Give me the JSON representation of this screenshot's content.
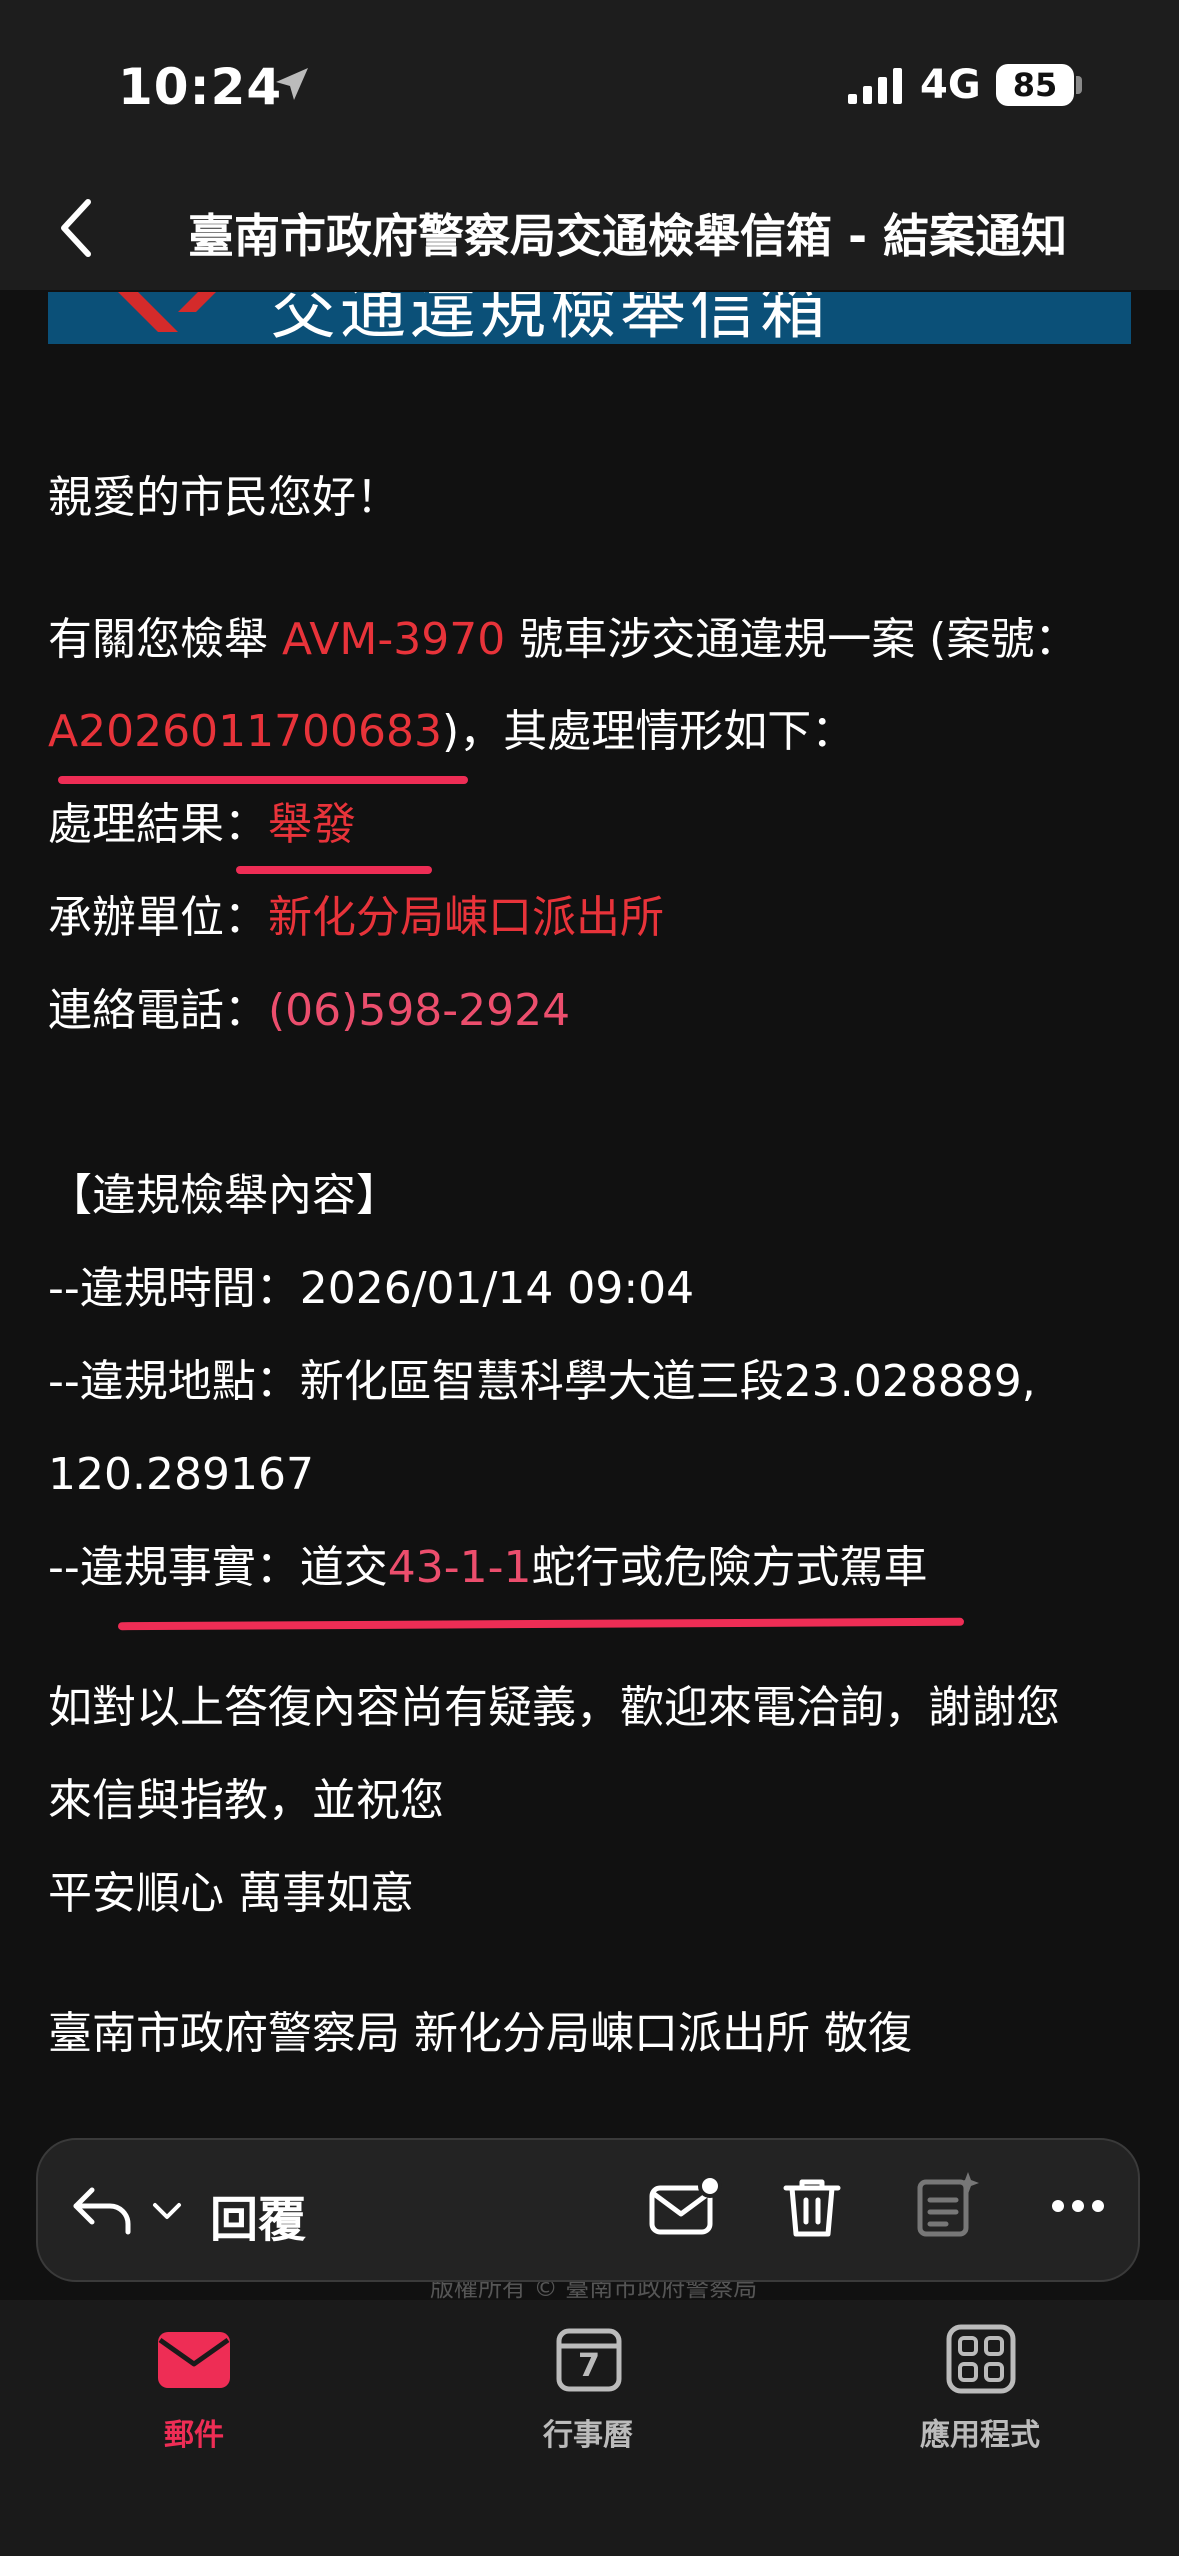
{
  "status": {
    "time": "10:24",
    "network": "4G",
    "battery": "85"
  },
  "nav": {
    "title": "臺南市政府警察局交通檢舉信箱 - 結案通知"
  },
  "banner": {
    "text": "交通違規檢舉信箱"
  },
  "email": {
    "greeting": "親愛的市民您好！",
    "line1_prefix": "有關您檢舉 ",
    "plate": "AVM-3970",
    "line1_suffix": " 號車涉交通違規一案 (案號：",
    "case_number": "A2026011700683",
    "line2_suffix": ")，其處理情形如下：",
    "result_label": "處理結果：",
    "result_value": "舉發",
    "unit_label": "承辦單位：",
    "unit_value": "新化分局崠口派出所",
    "phone_label": "連絡電話：",
    "phone_value": "(06)598-2924",
    "section_title": "【違規檢舉內容】",
    "time_line": "--違規時間：2026/01/14 09:04",
    "location_line": "--違規地點：新化區智慧科學大道三段23.028889,",
    "location_line2": "120.289167",
    "fact_prefix": "--違規事實：道交",
    "fact_code": "43-1-1",
    "fact_suffix": "蛇行或危險方式駕車",
    "closing1": "如對以上答復內容尚有疑義，歡迎來電洽詢，謝謝您",
    "closing2": "來信與指教，並祝您",
    "closing3": "平安順心 萬事如意",
    "signature": "臺南市政府警察局 新化分局崠口派出所 敬復",
    "footer_faint": "版權所有 © 臺南市政府警察局"
  },
  "toolbar": {
    "reply_label": "回覆"
  },
  "tabs": [
    {
      "label": "郵件",
      "active": true
    },
    {
      "label": "行事曆",
      "active": false,
      "calendar_day": "7"
    },
    {
      "label": "應用程式",
      "active": false
    }
  ],
  "colors": {
    "accent": "#ee2d55",
    "highlight_red": "#e8333a",
    "banner_blue": "#0b5078"
  }
}
